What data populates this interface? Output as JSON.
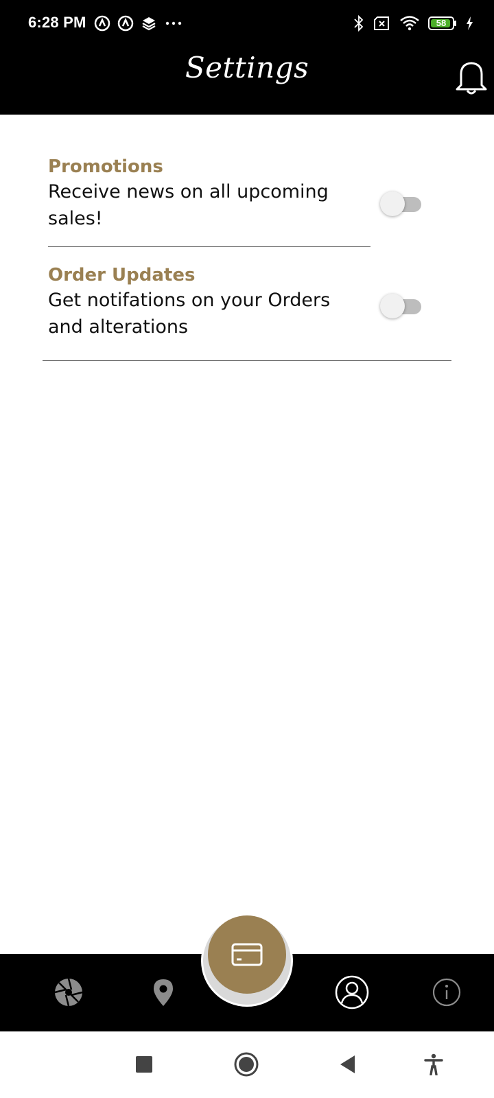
{
  "status_bar": {
    "time": "6:28 PM",
    "battery": "58",
    "left_icons": [
      "notification-icon-1",
      "notification-icon-2",
      "layers-icon",
      "more-dots-icon"
    ],
    "right_icons": [
      "bluetooth-icon",
      "sim-off-icon",
      "wifi-icon",
      "battery-icon",
      "charging-icon"
    ]
  },
  "header": {
    "title": "Settings",
    "bell_icon": "bell-icon"
  },
  "settings": [
    {
      "title": "Promotions",
      "description": "Receive news on all upcoming sales!",
      "enabled": false
    },
    {
      "title": "Order Updates",
      "description": "Get notifations on your Orders and alterations",
      "enabled": false
    }
  ],
  "bottom_nav": {
    "items": [
      "aperture-icon",
      "location-pin-icon",
      "card-icon",
      "profile-icon",
      "info-icon"
    ],
    "active": "profile-icon"
  },
  "system_nav": {
    "buttons": [
      "recents-button",
      "home-button",
      "back-button",
      "accessibility-button"
    ]
  },
  "colors": {
    "accent": "#9a8052",
    "header_bg": "#000000",
    "text": "#111111"
  }
}
